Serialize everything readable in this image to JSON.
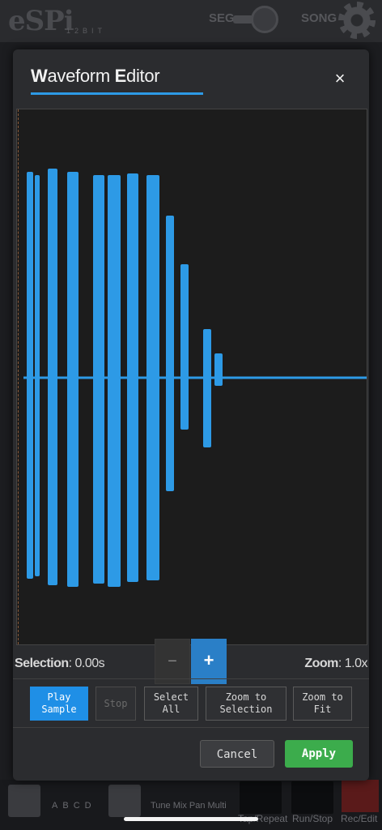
{
  "app": {
    "logo": "eSPi",
    "bits": "12BIT",
    "seg_label": "SEG",
    "song_label": "SONG",
    "bottom_groups": [
      "A",
      "B",
      "C",
      "D"
    ],
    "bottom_params": "Tune Mix Pan Multi",
    "transport": [
      "Tap/Repeat",
      "Run/Stop",
      "Rec/Edit"
    ]
  },
  "modal": {
    "title_w": "W",
    "title_rest1": "aveform ",
    "title_e": "E",
    "title_rest2": "ditor",
    "close_symbol": "×",
    "accent": "#2d9ae6"
  },
  "waveform": {
    "color": "#2d9ae6",
    "background": "#1c1c1c"
  },
  "info": {
    "selection_label": "Selection",
    "selection_value": ": 0.00s",
    "zoom_label": "Zoom",
    "zoom_value": ": 1.0x",
    "zoom_out": "−",
    "zoom_in": "+"
  },
  "toolbar": {
    "play_sample": "Play\nSample",
    "stop": "Stop",
    "select_all": "Select\nAll",
    "zoom_selection": "Zoom to\nSelection",
    "zoom_fit": "Zoom to\nFit"
  },
  "footer": {
    "cancel": "Cancel",
    "apply": "Apply",
    "apply_color": "#3cac4c"
  }
}
